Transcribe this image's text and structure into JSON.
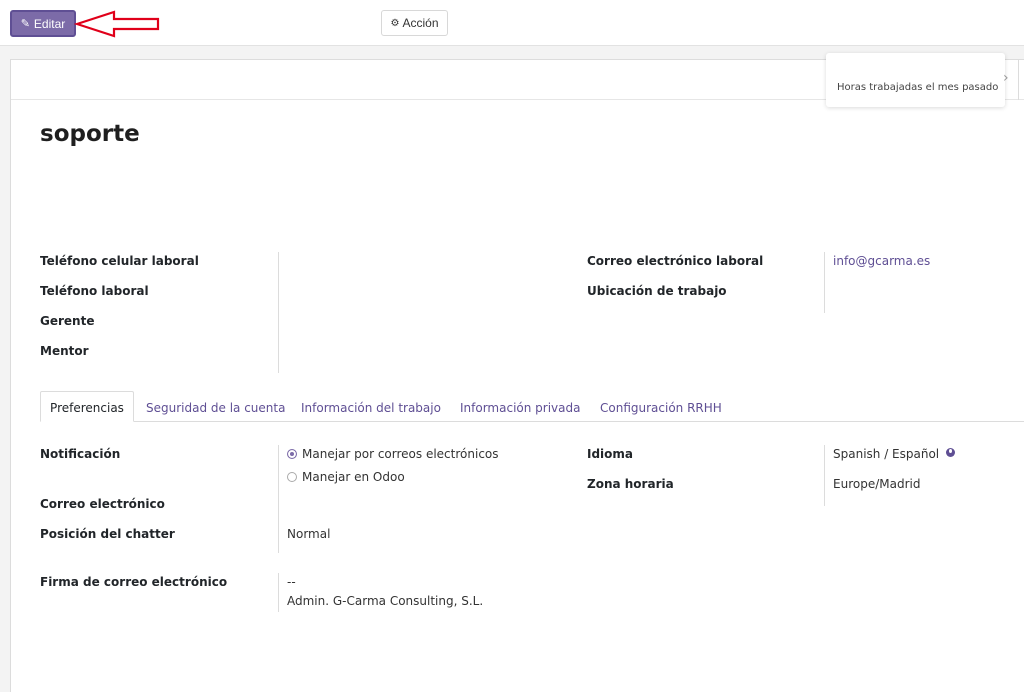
{
  "toolbar": {
    "edit_label": "Editar",
    "action_label": "Acción"
  },
  "stat_button": {
    "label": "Horas trabajadas el mes pasado"
  },
  "record": {
    "title": "soporte"
  },
  "header_fields": {
    "mobile_phone_label": "Teléfono celular laboral",
    "work_phone_label": "Teléfono laboral",
    "manager_label": "Gerente",
    "coach_label": "Mentor",
    "work_email_label": "Correo electrónico laboral",
    "work_email_value": "info@gcarma.es",
    "work_location_label": "Ubicación de trabajo"
  },
  "tabs": [
    {
      "label": "Preferencias"
    },
    {
      "label": "Seguridad de la cuenta"
    },
    {
      "label": "Información del trabajo"
    },
    {
      "label": "Información privada"
    },
    {
      "label": "Configuración RRHH"
    }
  ],
  "preferences": {
    "notification_label": "Notificación",
    "notification_options": [
      {
        "label": "Manejar por correos electrónicos",
        "checked": true
      },
      {
        "label": "Manejar en Odoo",
        "checked": false
      }
    ],
    "email_label": "Correo electrónico",
    "chatter_label": "Posición del chatter",
    "chatter_value": "Normal",
    "signature_label": "Firma de correo electrónico",
    "signature_line1": "--",
    "signature_line2": "Admin. G-Carma Consulting, S.L.",
    "language_label": "Idioma",
    "language_value": "Spanish / Español",
    "timezone_label": "Zona horaria",
    "timezone_value": "Europe/Madrid"
  },
  "icons": {
    "edit": "pencil-icon",
    "action": "gear-icon",
    "next": "chevron-right-icon",
    "language": "globe-icon",
    "annotation": "red-arrow-annotation"
  },
  "colors": {
    "primary": "#7c6ba8",
    "link": "#5f4f94",
    "annotation": "#e0001a"
  }
}
